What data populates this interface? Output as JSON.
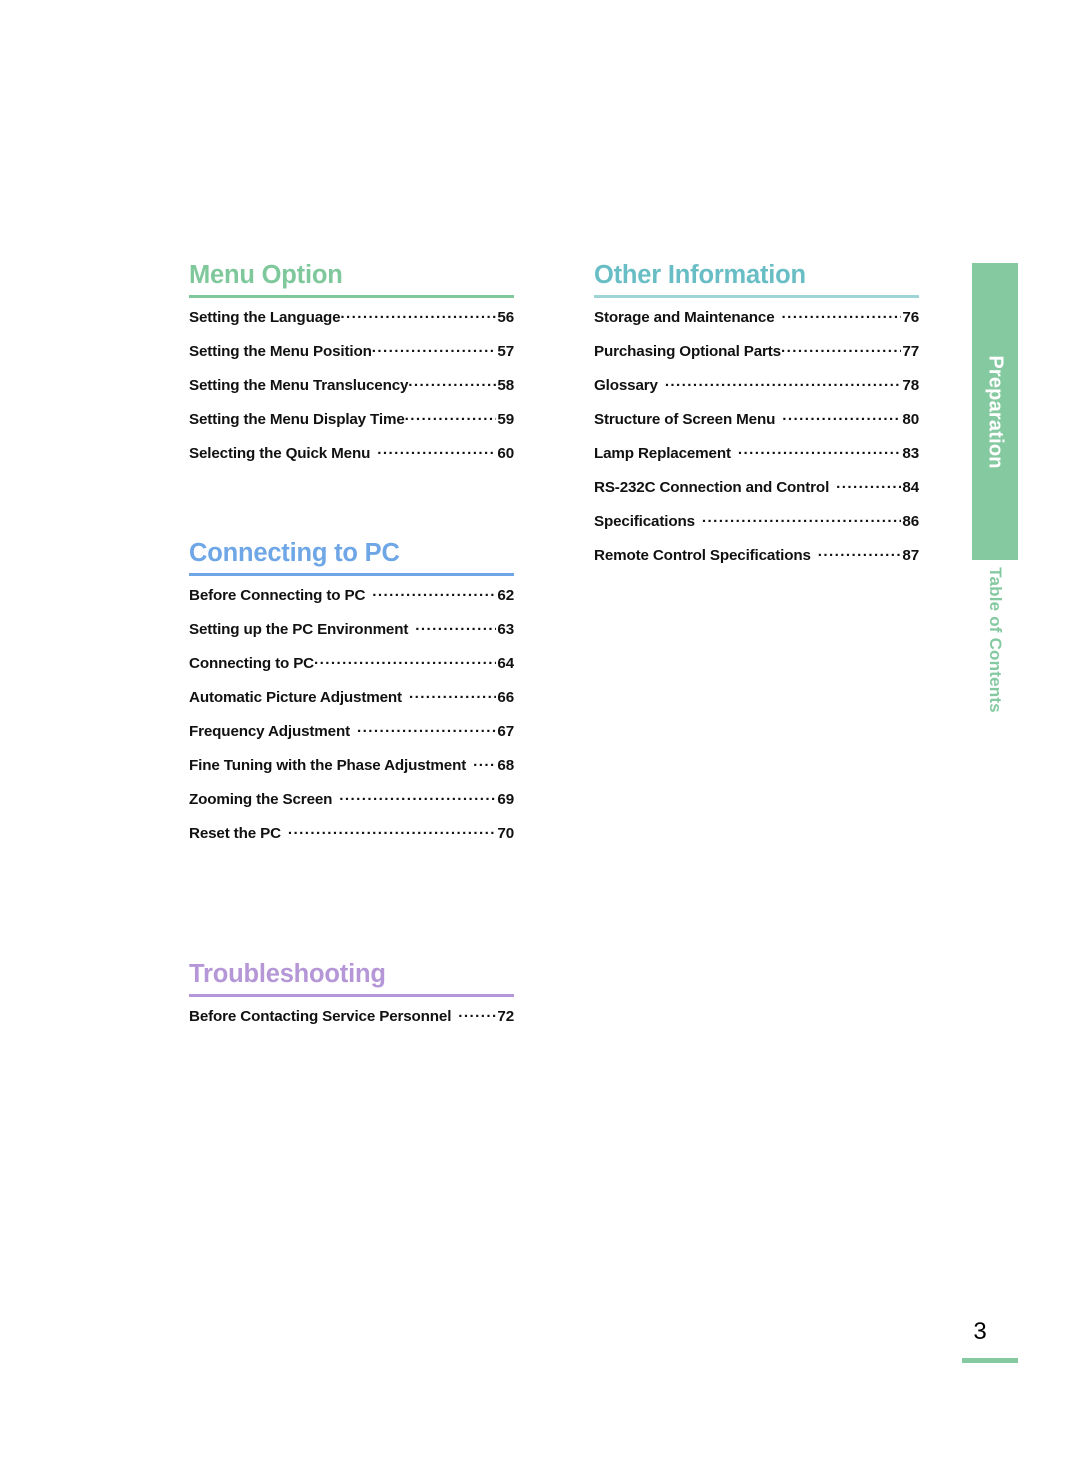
{
  "page": {
    "number": "3",
    "accent_green": "#7FC89B",
    "accent_teal": "#69BEC5",
    "accent_blue": "#6FA6E6",
    "accent_purple": "#B597D7",
    "tab_green": "#85C9A0"
  },
  "side_tab": {
    "chapter_label": "Preparation",
    "section_label": "Table of Contents"
  },
  "sections": [
    {
      "title": "Menu Option",
      "entries": [
        {
          "label": "Setting the Language",
          "page": "56",
          "gap": false
        },
        {
          "label": "Setting the Menu Position",
          "page": "57",
          "gap": false
        },
        {
          "label": "Setting the Menu Translucency",
          "page": "58",
          "gap": false
        },
        {
          "label": "Setting the Menu Display Time",
          "page": "59",
          "gap": false
        },
        {
          "label": "Selecting the Quick Menu",
          "page": "60",
          "gap": true
        }
      ]
    },
    {
      "title": "Connecting to PC",
      "entries": [
        {
          "label": "Before Connecting to PC",
          "page": "62",
          "gap": true
        },
        {
          "label": "Setting up the PC Environment",
          "page": "63",
          "gap": true
        },
        {
          "label": "Connecting to PC",
          "page": "64",
          "gap": false
        },
        {
          "label": "Automatic Picture Adjustment",
          "page": "66",
          "gap": true
        },
        {
          "label": "Frequency Adjustment",
          "page": "67",
          "gap": true
        },
        {
          "label": "Fine Tuning with the Phase Adjustment",
          "page": "68",
          "gap": true
        },
        {
          "label": "Zooming the Screen",
          "page": "69",
          "gap": true
        },
        {
          "label": "Reset the PC",
          "page": "70",
          "gap": true
        }
      ]
    },
    {
      "title": "Troubleshooting",
      "entries": [
        {
          "label": "Before Contacting Service Personnel",
          "page": "72",
          "gap": true
        }
      ]
    },
    {
      "title": "Other Information",
      "entries": [
        {
          "label": "Storage and Maintenance",
          "page": "76",
          "gap": true
        },
        {
          "label": "Purchasing Optional Parts",
          "page": "77",
          "gap": false
        },
        {
          "label": "Glossary",
          "page": "78",
          "gap": true
        },
        {
          "label": "Structure of Screen Menu",
          "page": "80",
          "gap": true
        },
        {
          "label": "Lamp Replacement",
          "page": "83",
          "gap": true
        },
        {
          "label": "RS-232C Connection and Control",
          "page": "84",
          "gap": true
        },
        {
          "label": "Specifications",
          "page": "86",
          "gap": true
        },
        {
          "label": "Remote Control Specifications",
          "page": "87",
          "gap": true
        }
      ]
    }
  ]
}
